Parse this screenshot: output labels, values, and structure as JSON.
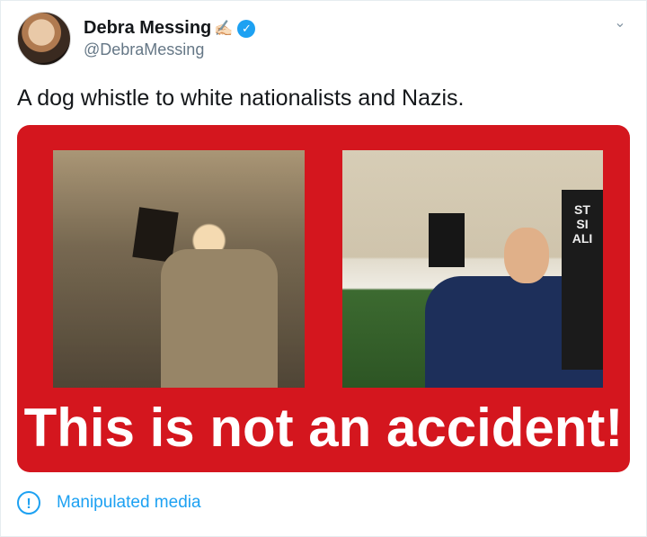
{
  "author": {
    "display_name": "Debra Messing",
    "emoji": "✍🏻",
    "handle": "@DebraMessing",
    "verified_icon": "verified-badge-icon"
  },
  "tweet": {
    "text": "A dog whistle to white nationalists and Nazis."
  },
  "media": {
    "caption": "This is not an accident!",
    "sign_text": "ST\nSI\nALI",
    "background_color": "#d4161e"
  },
  "notice": {
    "icon": "exclamation-circle-icon",
    "label": "Manipulated media"
  },
  "colors": {
    "link": "#1da1f2",
    "secondary_text": "#657786"
  }
}
